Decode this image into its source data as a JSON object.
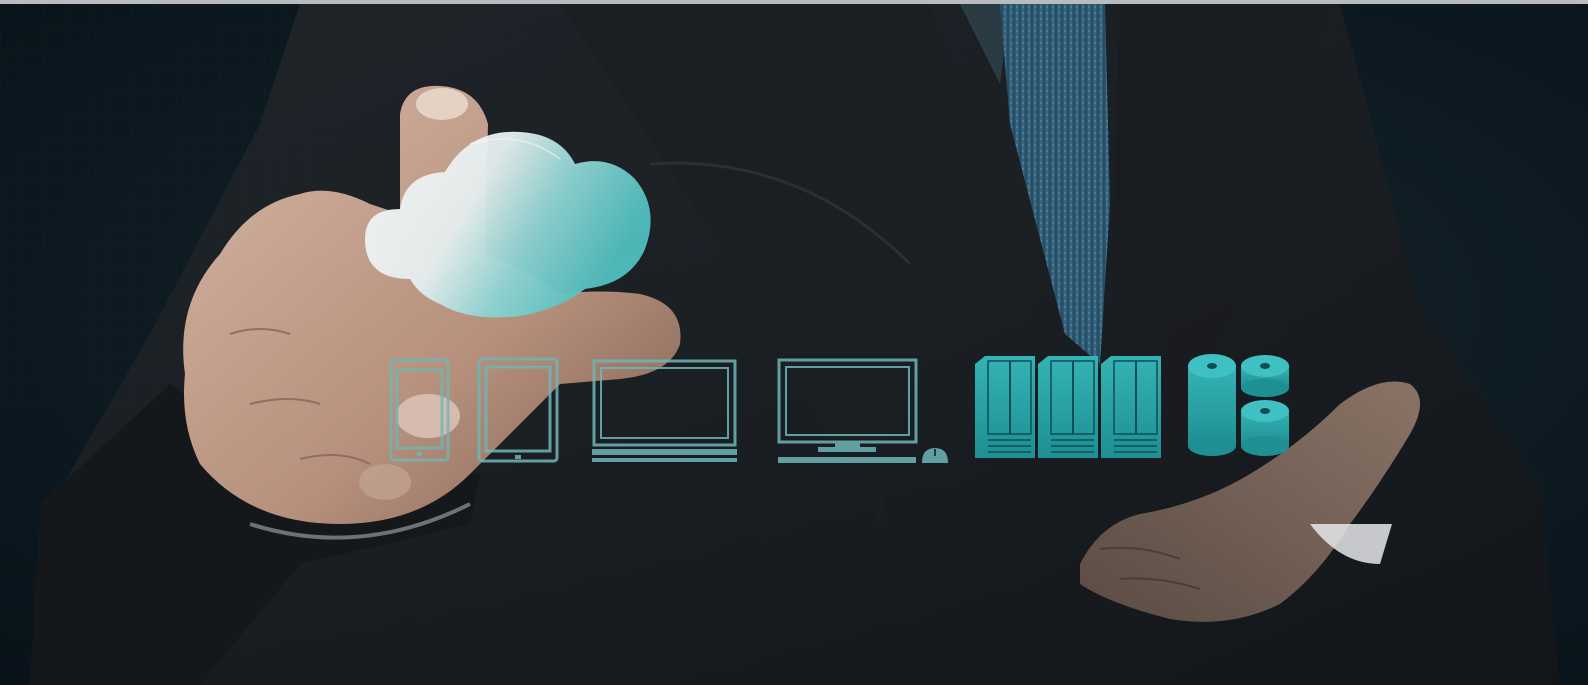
{
  "hero_image": {
    "colors": {
      "background_dark": "#0b1820",
      "suit": "#1a1d21",
      "tie": "#2f5f7a",
      "skin": "#c6a48f",
      "cloud_white": "#f2f4f4",
      "cloud_teal": "#5cc7c6",
      "device_outline": "#6fb6b6",
      "server_fill": "#27a3a6",
      "storage_fill": "#21a0a4",
      "top_strip": "#b9bcbf"
    },
    "icons": [
      "cloud-icon",
      "smartphone-icon",
      "tablet-icon",
      "laptop-icon",
      "desktop-computer-icon",
      "mouse-icon",
      "server-rack-icon",
      "database-storage-icon"
    ]
  }
}
